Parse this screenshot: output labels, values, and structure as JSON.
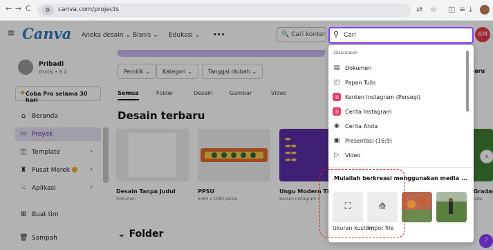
{
  "browser": {
    "url": "canva.com/projects",
    "nav": {
      "back": "←",
      "forward": "→",
      "reload": "C"
    },
    "icons": [
      "translate-icon",
      "star-icon",
      "extension-icon",
      "split-icon",
      "download-icon",
      "profile-icon"
    ]
  },
  "header": {
    "logo": "Canva",
    "nav": [
      "Aneka desain",
      "Bisnis",
      "Edukasi",
      "•••"
    ],
    "search_button": "Cari konten",
    "avatar": "AM"
  },
  "sidebar": {
    "profile_name": "Pribadi",
    "profile_sub": "Gratis • 8 1",
    "try_pro": "Coba Pro selama 30 hari",
    "items": [
      {
        "label": "Beranda",
        "icon": "home-icon",
        "active": false
      },
      {
        "label": "Proyek",
        "icon": "folder-icon",
        "active": true
      },
      {
        "label": "Template",
        "icon": "template-icon",
        "active": false
      },
      {
        "label": "Pusat Merek",
        "icon": "brand-icon",
        "active": false
      },
      {
        "label": "Aplikasi",
        "icon": "apps-icon",
        "active": false
      },
      {
        "label": "Buat tim",
        "icon": "team-icon",
        "active": false
      },
      {
        "label": "Sampah",
        "icon": "trash-icon",
        "active": false
      }
    ]
  },
  "main": {
    "filters": [
      "Pemilik",
      "Kategori",
      "Tanggal diubah"
    ],
    "tabs": [
      "Semua",
      "Folder",
      "Desain",
      "Gambar",
      "Video"
    ],
    "section_title": "Desain terbaru",
    "folder_title": "Folder",
    "create_partial": "n baru",
    "cards": [
      {
        "title": "Desain Tanpa Judul",
        "sub": "Dokumen"
      },
      {
        "title": "PPSU",
        "sub": "6480 x 1080 piksel"
      },
      {
        "title": "Ungu Modern Tip",
        "sub": "Konten Instagram ("
      },
      {
        "title": "n Gradas",
        "sub": "ouTube"
      }
    ]
  },
  "search": {
    "placeholder": "Cari",
    "section_label": "Disarankan",
    "suggestions": [
      {
        "label": "Dokumen",
        "icon": "document-icon"
      },
      {
        "label": "Papan Tulis",
        "icon": "whiteboard-icon"
      },
      {
        "label": "Konten Instagram (Persegi)",
        "icon": "instagram-icon"
      },
      {
        "label": "Cerita Instagram",
        "icon": "instagram-icon"
      },
      {
        "label": "Cerita Anda",
        "icon": "story-icon"
      },
      {
        "label": "Presentasi (16:9)",
        "icon": "presentation-icon"
      },
      {
        "label": "Video",
        "icon": "video-icon"
      }
    ],
    "media_title": "Mulailah berkreasi menggunakan media ...",
    "custom_size": "Ukuran kustom",
    "import_file": "Impor file"
  },
  "help_label": "?"
}
